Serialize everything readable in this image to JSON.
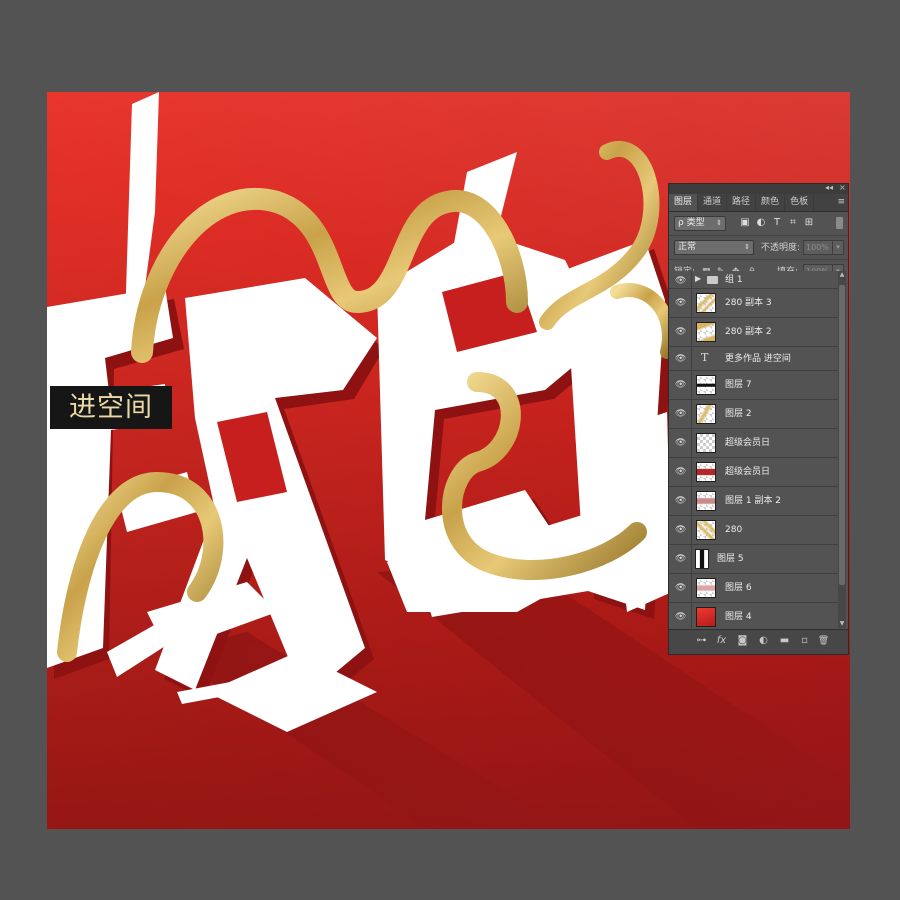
{
  "canvas": {
    "badge_text": "进空间",
    "artwork_glyphs": "级会员",
    "colors": {
      "background_top": "#e8332a",
      "background_bottom": "#a3171a",
      "brush_text": "#ffffff",
      "ribbon_gold": "#d4b25a",
      "badge_bg": "#161616",
      "badge_text": "#e9d9a6"
    }
  },
  "panel": {
    "collapse_glyph": "◂◂",
    "close_glyph": "×",
    "tabs": [
      "图层",
      "通道",
      "路径",
      "颜色",
      "色板"
    ],
    "active_tab": "图层",
    "filter": {
      "search_glyph": "ρ",
      "value": "类型",
      "icons": [
        "image-icon",
        "adjustment-icon",
        "type-icon",
        "shape-icon",
        "smart-object-icon"
      ],
      "icon_glyphs": [
        "▣",
        "◐",
        "T",
        "⌗",
        "⊞"
      ]
    },
    "blend_mode": "正常",
    "opacity_label": "不透明度:",
    "opacity_value": "100%",
    "lock_label": "锁定:",
    "lock_icons": [
      "▦",
      "✎",
      "✥",
      "🔒"
    ],
    "fill_label": "填充:",
    "fill_value": "100%",
    "layers": [
      {
        "name": "组 1",
        "type": "group",
        "thumb": ""
      },
      {
        "name": "280 副本 3",
        "type": "pixel",
        "thumb": "gold"
      },
      {
        "name": "280 副本 2",
        "type": "pixel",
        "thumb": "gold"
      },
      {
        "name": "更多作品 进空间",
        "type": "text",
        "thumb": "T"
      },
      {
        "name": "图层 7",
        "type": "pixel",
        "thumb": "black-stroke"
      },
      {
        "name": "图层 2",
        "type": "pixel",
        "thumb": "gold"
      },
      {
        "name": "超级会员日",
        "type": "pixel",
        "thumb": "transparent"
      },
      {
        "name": "超级会员日",
        "type": "pixel",
        "thumb": "red-text"
      },
      {
        "name": "图层 1 副本 2",
        "type": "pixel",
        "thumb": "pinkish"
      },
      {
        "name": "280",
        "type": "pixel",
        "thumb": "gold"
      },
      {
        "name": "图层 5",
        "type": "pixel",
        "thumb": "dark"
      },
      {
        "name": "图层 6",
        "type": "pixel",
        "thumb": "pinkish"
      },
      {
        "name": "图层 4",
        "type": "pixel",
        "thumb": "red"
      }
    ],
    "bottom_icons": [
      "⊶",
      "fx",
      "◙",
      "◐",
      "▬",
      "▫",
      "🗑"
    ],
    "bottom_icon_names": [
      "link-layers-icon",
      "fx-icon",
      "add-mask-icon",
      "new-adjustment-icon",
      "new-group-icon",
      "new-layer-icon",
      "delete-layer-icon"
    ]
  }
}
